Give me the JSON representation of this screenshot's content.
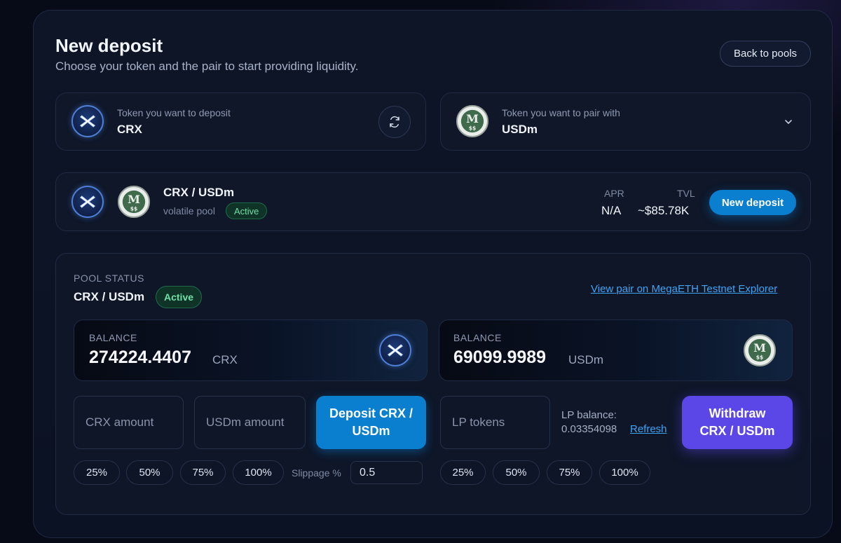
{
  "header": {
    "title": "New deposit",
    "subtitle": "Choose your token and the pair to start providing liquidity.",
    "back_label": "Back to pools"
  },
  "deposit_token": {
    "label": "Token you want to deposit",
    "symbol": "CRX"
  },
  "pair_token": {
    "label": "Token you want to pair with",
    "symbol": "USDm"
  },
  "pool_row": {
    "pair": "CRX / USDm",
    "type": "volatile pool",
    "status": "Active",
    "apr_label": "APR",
    "apr_value": "N/A",
    "tvl_label": "TVL",
    "tvl_value": "~$85.78K",
    "button": "New deposit"
  },
  "pool_status": {
    "heading": "POOL STATUS",
    "pair": "CRX / USDm",
    "status": "Active",
    "explorer_link": "View pair on MegaETH Testnet Explorer",
    "balance_label": "BALANCE",
    "balance_crx": "274224.4407",
    "balance_crx_unit": "CRX",
    "balance_usdm": "69099.9989",
    "balance_usdm_unit": "USDm"
  },
  "deposit_form": {
    "crx_placeholder": "CRX amount",
    "usdm_placeholder": "USDm amount",
    "button": "Deposit CRX / USDm",
    "percents": [
      "25%",
      "50%",
      "75%",
      "100%"
    ],
    "slippage_label": "Slippage %",
    "slippage_value": "0.5"
  },
  "withdraw_form": {
    "lp_placeholder": "LP tokens",
    "lp_balance_label": "LP balance:",
    "lp_balance_value": "0.03354098",
    "refresh": "Refresh",
    "button": "Withdraw CRX / USDm",
    "percents": [
      "25%",
      "50%",
      "75%",
      "100%"
    ]
  },
  "icons": {
    "crx": "crx-token-icon",
    "usdm": "usdm-token-icon",
    "swap": "swap-icon",
    "chevron": "chevron-down-icon"
  },
  "colors": {
    "accent_blue": "#0a7fd0",
    "accent_purple": "#5b47e8",
    "active_green": "#6fe0a8",
    "link": "#3ea4f5"
  }
}
